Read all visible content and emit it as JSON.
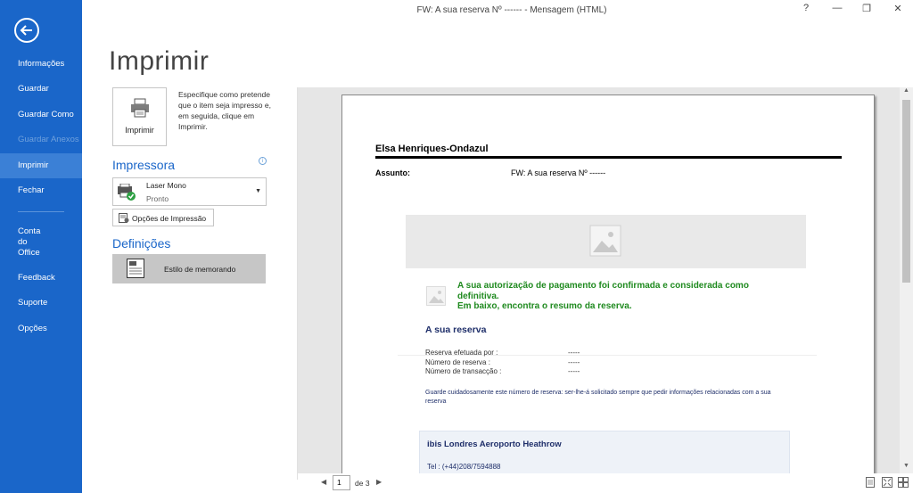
{
  "window": {
    "title": "FW: A sua reserva Nº ------  -  Mensagem (HTML)",
    "help": "?",
    "minimize": "—",
    "restore": "❐",
    "close": "✕"
  },
  "sidebar": {
    "items": [
      {
        "label": "Informações",
        "state": "normal"
      },
      {
        "label": "Guardar",
        "state": "normal"
      },
      {
        "label": "Guardar Como",
        "state": "normal"
      },
      {
        "label": "Guardar Anexos",
        "state": "disabled"
      },
      {
        "label": "Imprimir",
        "state": "active"
      },
      {
        "label": "Fechar",
        "state": "normal"
      },
      {
        "label": "Conta\ndo\nOffice",
        "state": "normal"
      },
      {
        "label": "Feedback",
        "state": "normal"
      },
      {
        "label": "Suporte",
        "state": "normal"
      },
      {
        "label": "Opções",
        "state": "normal"
      }
    ],
    "accent": "#1a66c9"
  },
  "print_panel": {
    "title": "Imprimir",
    "print_button": "Imprimir",
    "description": "Especifique como pretende que o item seja impresso e, em seguida, clique em Imprimir.",
    "printer_heading": "Impressora",
    "printer_name": "Laser Mono",
    "printer_status": "Pronto",
    "printer_options": "Opções de Impressão",
    "settings_heading": "Definições",
    "style": "Estilo de memorando"
  },
  "preview": {
    "sender": "Elsa Henriques-Ondazul",
    "subject_label": "Assunto:",
    "subject_value": "FW: A sua reserva Nº ------",
    "green_lines": [
      "A sua autorização de pagamento foi confirmada e considerada como",
      "definitiva.",
      "Em baixo, encontra o resumo da reserva."
    ],
    "reservation_heading": "A sua reserva",
    "rows": [
      {
        "label": "Reserva efetuada por :",
        "value": "-----"
      },
      {
        "label": "Número de reserva :",
        "value": "-----"
      },
      {
        "label": "Número de transacção :",
        "value": "-----"
      }
    ],
    "note": "Guarde cuidadosamente este número de reserva: ser-lhe-á solicitado sempre que pedir informações relacionadas com a sua reserva",
    "hotel_name": "ibis Londres Aeroporto Heathrow",
    "hotel_tel": "Tel : (+44)208/7594888"
  },
  "pager": {
    "current_page": "1",
    "of_pages": "de 3"
  }
}
